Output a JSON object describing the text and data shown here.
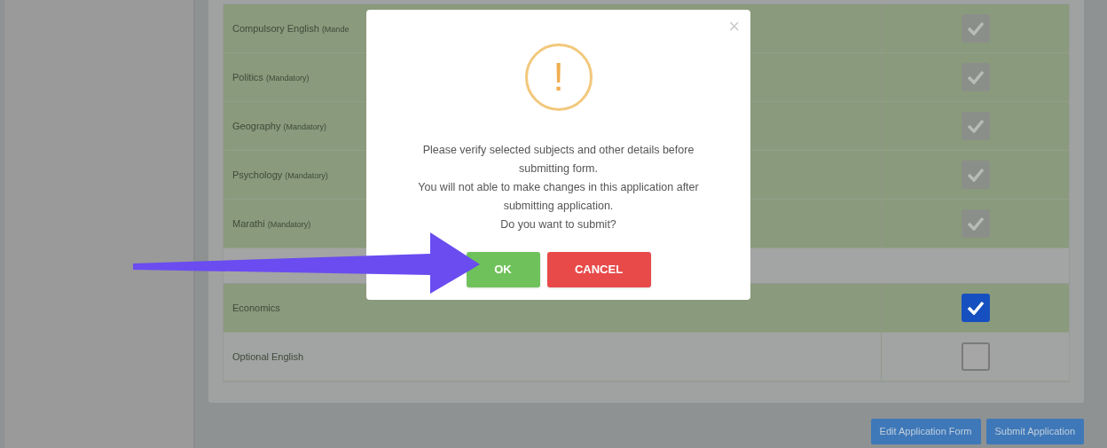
{
  "table": {
    "rows": [
      {
        "kind": "subject",
        "name": "Compulsory English ",
        "note": " (Mande",
        "checked": true,
        "disabled": true
      },
      {
        "kind": "subject",
        "name": "Politics ",
        "note": "(Mandatory)",
        "checked": true,
        "disabled": true
      },
      {
        "kind": "subject",
        "name": "Geography ",
        "note": "(Mandatory)",
        "checked": true,
        "disabled": true
      },
      {
        "kind": "subject",
        "name": "Psychology ",
        "note": "(Mandatory)",
        "checked": true,
        "disabled": true
      },
      {
        "kind": "subject",
        "name": "Marathi ",
        "note": "(Mandatory)",
        "checked": true,
        "disabled": true
      },
      {
        "kind": "spacer"
      },
      {
        "kind": "subject",
        "name": "Economics",
        "checked": true,
        "disabled": false
      },
      {
        "kind": "subject",
        "name": "Optional English",
        "checked": false,
        "disabled": false
      }
    ]
  },
  "actions": [
    "Edit Application Form",
    "Submit Application"
  ],
  "dialog": {
    "close": "×",
    "icon": "!",
    "lines": [
      "Please verify selected subjects and other details before submitting form.",
      "You will not able to make changes in this application after submitting application.",
      "Do you want to submit?"
    ],
    "buttons": [
      {
        "kind": "confirm",
        "label": "OK"
      },
      {
        "kind": "cancel",
        "label": "CANCEL"
      }
    ]
  },
  "annotation": {
    "kind": "arrow"
  }
}
